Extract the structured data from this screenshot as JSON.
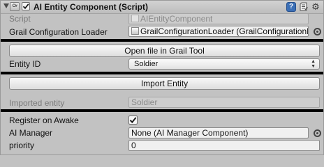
{
  "header": {
    "title": "AI Entity Component (Script)",
    "component_icon_text": "C#",
    "enabled": true,
    "icons": [
      "help-icon",
      "preset-icon",
      "gear-icon"
    ]
  },
  "fields": {
    "script": {
      "label": "Script",
      "value": "AIEntityComponent"
    },
    "grail_loader": {
      "label": "Grail Configuration Loader",
      "value": "GrailConfigurationLoader (GrailConfigurationLoader)"
    },
    "entity_id": {
      "label": "Entity ID",
      "value": "Soldier"
    },
    "imported_entity": {
      "label": "Imported entity",
      "value": "Soldier"
    },
    "register_on_awake": {
      "label": "Register on Awake",
      "checked": true
    },
    "ai_manager": {
      "label": "AI Manager",
      "value": "None (AI Manager Component)"
    },
    "priority": {
      "label": "priority",
      "value": "0"
    }
  },
  "buttons": {
    "open_file": "Open file in Grail Tool",
    "import_entity": "Import Entity"
  },
  "colors": {
    "panel": "#c2c2c2",
    "separator": "#000000",
    "help": "#3b6fb6"
  }
}
